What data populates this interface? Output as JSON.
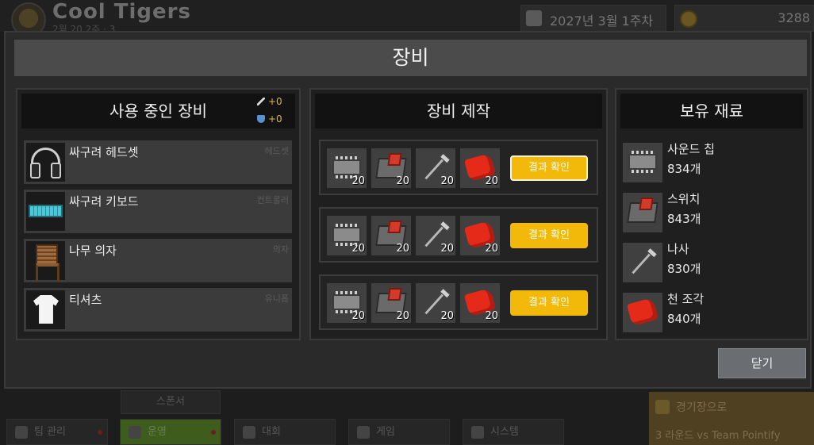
{
  "hud": {
    "team_name": "Cool Tigers",
    "team_sub": "2월 20 2주 · 3",
    "date": "2027년 3월 1주차",
    "money": "3288",
    "sponsor_label": "스폰서",
    "nav": [
      {
        "label": "팀 관리"
      },
      {
        "label": "운영"
      },
      {
        "label": "대회"
      },
      {
        "label": "게임"
      },
      {
        "label": "시스템"
      }
    ],
    "stadium": {
      "title": "경기장으로",
      "match": "3 라운드 vs Team Pointify"
    }
  },
  "modal": {
    "title": "장비",
    "equipped": {
      "header": "사용 중인 장비",
      "attack_bonus": "+0",
      "defense_bonus": "+0",
      "items": [
        {
          "name": "싸구려 헤드셋",
          "slot": "헤드셋",
          "icon": "headset-icon"
        },
        {
          "name": "싸구려 키보드",
          "slot": "컨트롤러",
          "icon": "keyboard-icon"
        },
        {
          "name": "나무 의자",
          "slot": "의자",
          "icon": "chair-icon"
        },
        {
          "name": "티셔츠",
          "slot": "유니폼",
          "icon": "tshirt-icon"
        }
      ]
    },
    "crafting": {
      "header": "장비 제작",
      "rows": [
        {
          "counts": [
            "20",
            "20",
            "20",
            "20"
          ],
          "button": "결과 확인"
        },
        {
          "counts": [
            "20",
            "20",
            "20",
            "20"
          ],
          "button": "결과 확인"
        },
        {
          "counts": [
            "20",
            "20",
            "20",
            "20"
          ],
          "button": "결과 확인"
        }
      ]
    },
    "owned": {
      "header": "보유 재료",
      "materials": [
        {
          "name": "사운드 칩",
          "count": "834개",
          "icon": "chip-icon"
        },
        {
          "name": "스위치",
          "count": "843개",
          "icon": "switch-icon"
        },
        {
          "name": "나사",
          "count": "830개",
          "icon": "screw-icon"
        },
        {
          "name": "천 조각",
          "count": "840개",
          "icon": "cloth-icon"
        }
      ]
    },
    "close_label": "닫기"
  },
  "colors": {
    "accent_button": "#f2b90a",
    "stat_text": "#e2b53a",
    "active_nav": "#3e5c1c"
  }
}
